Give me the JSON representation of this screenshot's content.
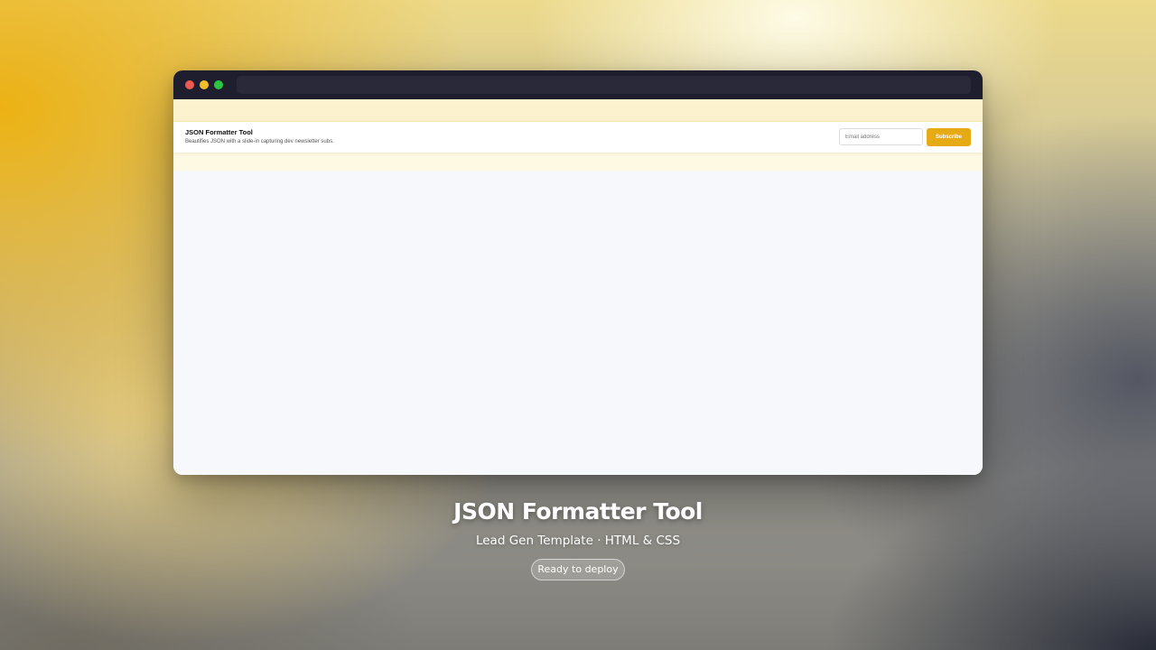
{
  "window": {
    "controls": {
      "close_color": "#ee5a52",
      "minimize_color": "#f4bd2b",
      "maximize_color": "#2bc640"
    }
  },
  "banner": {
    "title": "JSON Formatter Tool",
    "description": "Beautifies JSON with a slide-in capturing dev newsletter subs.",
    "email_placeholder": "Email address",
    "subscribe_label": "Subscribe",
    "accent_color": "#e6ab14"
  },
  "caption": {
    "title": "JSON Formatter Tool",
    "subtitle": "Lead Gen Template · HTML & CSS",
    "badge": "Ready to deploy"
  }
}
